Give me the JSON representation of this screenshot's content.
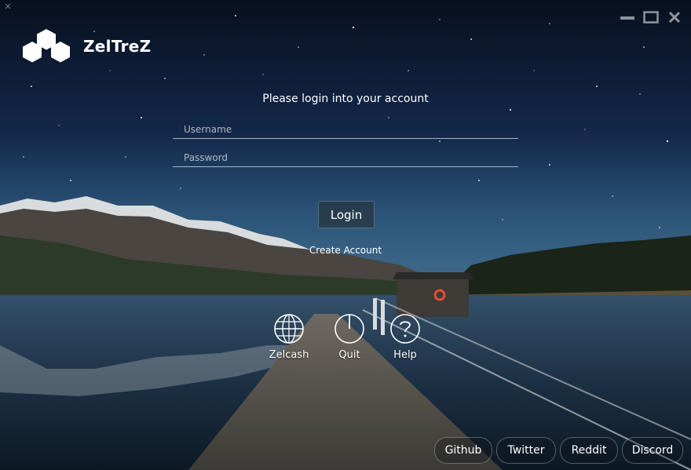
{
  "app": {
    "name": "ZelTreZ"
  },
  "login": {
    "title": "Please login into your account",
    "username_placeholder": "Username",
    "password_placeholder": "Password",
    "login_label": "Login",
    "create_account_label": "Create Account"
  },
  "quick_actions": [
    {
      "label": "Zelcash",
      "icon": "globe-icon"
    },
    {
      "label": "Quit",
      "icon": "power-icon"
    },
    {
      "label": "Help",
      "icon": "help-icon"
    }
  ],
  "footer_links": [
    "Github",
    "Twitter",
    "Reddit",
    "Discord"
  ],
  "window_controls": [
    "minimize-icon",
    "maximize-icon",
    "close-icon"
  ],
  "colors": {
    "sky_top": "#0a1428",
    "sky_bottom": "#2d5478",
    "button_bg": "#283a48",
    "text": "#ffffff"
  }
}
